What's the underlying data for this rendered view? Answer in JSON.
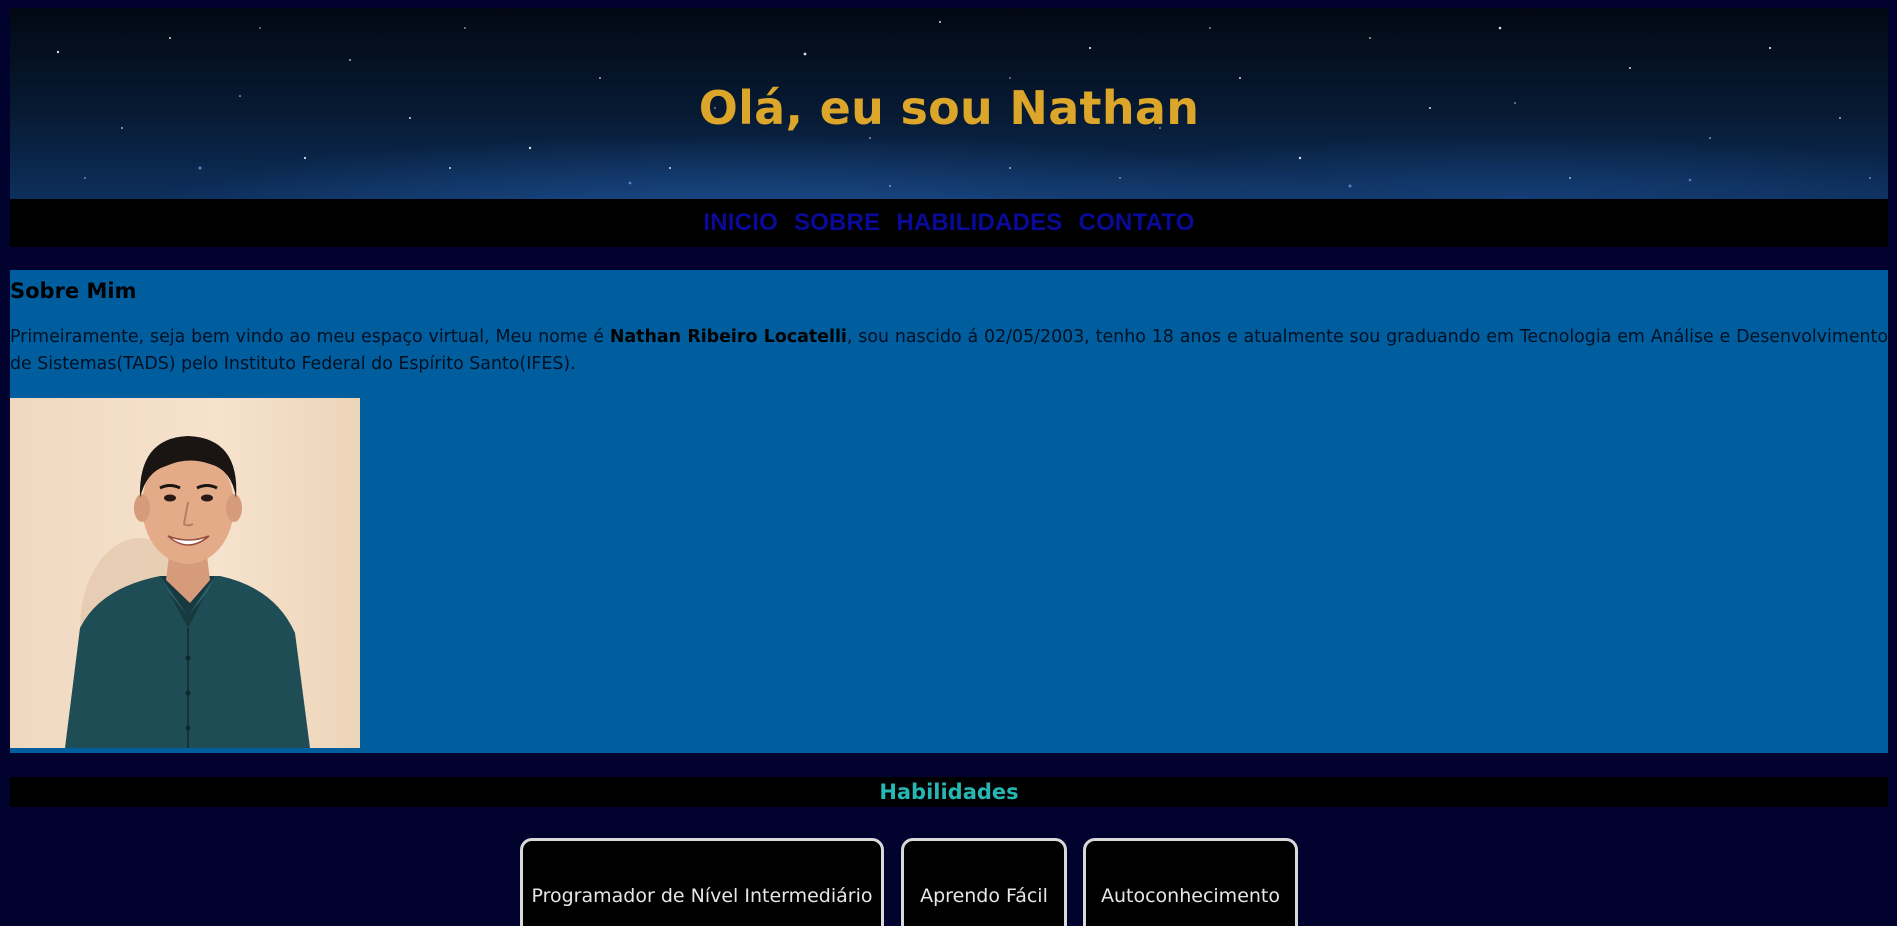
{
  "header": {
    "title": "Olá, eu sou Nathan"
  },
  "nav": {
    "items": [
      {
        "label": "INICIO"
      },
      {
        "label": "SOBRE"
      },
      {
        "label": "HABILIDADES"
      },
      {
        "label": "CONTATO"
      }
    ]
  },
  "about": {
    "heading": "Sobre Mim",
    "text_before": "Primeiramente, seja bem vindo ao meu espaço virtual, Meu nome é ",
    "name_bold": "Nathan Ribeiro Locatelli",
    "text_after": ", sou nascido á 02/05/2003, tenho 18 anos e atualmente sou graduando em Tecnologia em Análise e Desenvolvimento de Sistemas(TADS) pelo Instituto Federal do Espírito Santo(IFES).",
    "photo_alt": "Foto de perfil"
  },
  "skills": {
    "heading": "Habilidades",
    "cards": [
      {
        "label": "Programador de Nível Intermediário"
      },
      {
        "label": "Aprendo Fácil"
      },
      {
        "label": "Autoconhecimento"
      }
    ]
  },
  "colors": {
    "page_background": "#02022e",
    "title": "#dba629",
    "nav_link": "#0a0a9a",
    "about_background": "#005e9e",
    "skills_heading": "#27b7b2"
  }
}
